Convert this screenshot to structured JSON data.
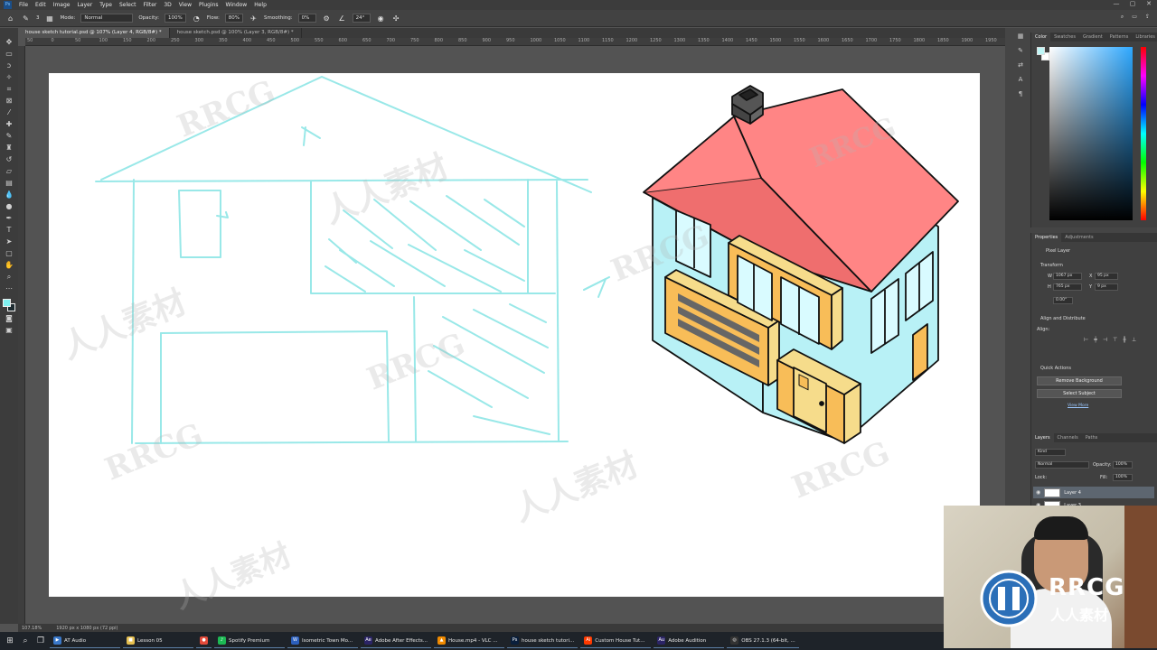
{
  "menubar": {
    "items": [
      "File",
      "Edit",
      "Image",
      "Layer",
      "Type",
      "Select",
      "Filter",
      "3D",
      "View",
      "Plugins",
      "Window",
      "Help"
    ],
    "window_controls": [
      "—",
      "▢",
      "✕"
    ]
  },
  "options": {
    "mode_label": "Mode:",
    "mode_value": "Normal",
    "opacity_label": "Opacity:",
    "opacity_value": "100%",
    "flow_label": "Flow:",
    "flow_value": "80%",
    "smoothing_label": "Smoothing:",
    "smoothing_value": "0%",
    "angle_value": "24°",
    "brush_size": "3"
  },
  "tabs": [
    {
      "label": "house sketch tutorial.psd @ 107% (Layer 4, RGB/8#) *"
    },
    {
      "label": "house sketch.psd @ 100% (Layer 3, RGB/8#) *"
    }
  ],
  "ruler_ticks": [
    "50",
    "0",
    "50",
    "100",
    "150",
    "200",
    "250",
    "300",
    "350",
    "400",
    "450",
    "500",
    "550",
    "600",
    "650",
    "700",
    "750",
    "800",
    "850",
    "900",
    "950",
    "1000",
    "1050",
    "1100",
    "1150",
    "1200",
    "1250",
    "1300",
    "1350",
    "1400",
    "1450",
    "1500",
    "1550",
    "1600",
    "1650",
    "1700",
    "1750",
    "1800",
    "1850",
    "1900",
    "1950"
  ],
  "color_panel": {
    "tabs": [
      "Color",
      "Swatches",
      "Gradient",
      "Patterns",
      "Libraries"
    ],
    "foreground": "#bff6f6"
  },
  "properties": {
    "tabs": [
      "Properties",
      "Adjustments"
    ],
    "layer_type": "Pixel Layer",
    "transform_title": "Transform",
    "w_label": "W",
    "w_value": "1067 px",
    "x_label": "X",
    "x_value": "95 px",
    "h_label": "H",
    "h_value": "765 px",
    "y_label": "Y",
    "y_value": "9 px",
    "angle_value": "0.00°",
    "align_title": "Align and Distribute",
    "align_label": "Align:",
    "quick_actions_title": "Quick Actions",
    "remove_bg": "Remove Background",
    "select_subject": "Select Subject",
    "view_more": "View More"
  },
  "layers": {
    "tabs": [
      "Layers",
      "Channels",
      "Paths"
    ],
    "kind_label": "Kind",
    "blend_mode": "Normal",
    "opacity_label": "Opacity:",
    "opacity_value": "100%",
    "lock_label": "Lock:",
    "fill_label": "Fill:",
    "fill_value": "100%",
    "items": [
      {
        "name": "Layer 4",
        "active": true
      },
      {
        "name": "Layer 3",
        "active": false
      }
    ]
  },
  "status": {
    "zoom": "107.18%",
    "doc_size": "1920 px x 1080 px (72 ppi)"
  },
  "taskbar": {
    "apps": [
      {
        "label": "AT Audio",
        "color": "#3a78c9",
        "glyph": "▶"
      },
      {
        "label": "Lesson 05",
        "color": "#e6c050",
        "glyph": "■"
      },
      {
        "label": "",
        "color": "#e34a3a",
        "glyph": "●"
      },
      {
        "label": "Spotify Premium",
        "color": "#1db954",
        "glyph": "♪"
      },
      {
        "label": "Isometric Town Mo...",
        "color": "#2b5fbd",
        "glyph": "W"
      },
      {
        "label": "Adobe After Effects...",
        "color": "#2b2466",
        "glyph": "Ae"
      },
      {
        "label": "House.mp4 - VLC ...",
        "color": "#f08a00",
        "glyph": "▲"
      },
      {
        "label": "house sketch tutori...",
        "color": "#0a1f3c",
        "glyph": "Ps"
      },
      {
        "label": "Custom House Tut...",
        "color": "#ff3a00",
        "glyph": "Ai"
      },
      {
        "label": "Adobe Audition",
        "color": "#2b2466",
        "glyph": "Au"
      },
      {
        "label": "OBS 27.1.3 (64-bit, ...",
        "color": "#333",
        "glyph": "◎"
      }
    ]
  },
  "watermark": {
    "latin": "RRCG",
    "cjk": "人人素材"
  },
  "colors": {
    "sketch": "#8ee6e6",
    "roof": "#ff8585",
    "roof_dark": "#ef6e6e",
    "wall": "#b8f1f6",
    "gold": "#f8bd58",
    "gold_light": "#f6dc8b",
    "chimney": "#555555"
  }
}
